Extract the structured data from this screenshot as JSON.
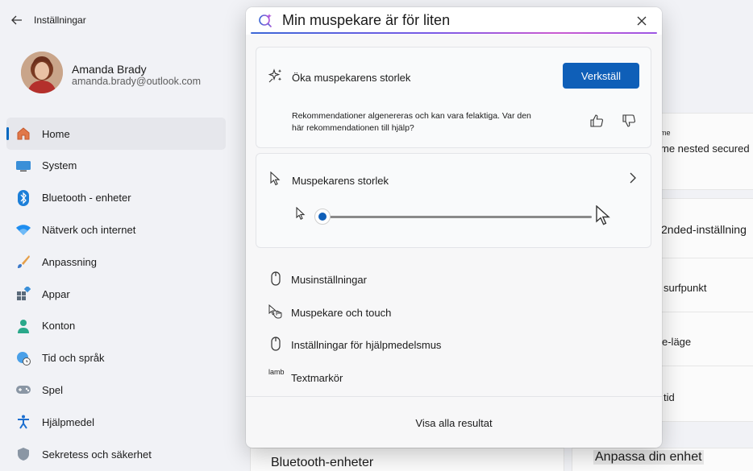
{
  "app": {
    "title": "Inställningar",
    "back_icon": "arrow-left-icon"
  },
  "profile": {
    "name": "Amanda Brady",
    "email": "amanda.brady@outlook.com"
  },
  "nav": [
    {
      "label": "Home",
      "icon": "home-icon",
      "active": true
    },
    {
      "label": "System",
      "icon": "monitor-icon"
    },
    {
      "label": "Bluetooth - enheter",
      "icon": "bluetooth-icon"
    },
    {
      "label": "Nätverk och internet",
      "icon": "wifi-icon"
    },
    {
      "label": "Anpassning",
      "icon": "brush-icon"
    },
    {
      "label": "Appar",
      "icon": "apps-icon"
    },
    {
      "label": "Konton",
      "icon": "person-icon"
    },
    {
      "label": "Tid och språk",
      "icon": "globe-clock-icon"
    },
    {
      "label": "Spel",
      "icon": "gamepad-icon"
    },
    {
      "label": "Hjälpmedel",
      "icon": "accessibility-icon"
    },
    {
      "label": "Sekretess och säkerhet",
      "icon": "shield-icon"
    }
  ],
  "background": {
    "fragment_me": "me",
    "fragment_nested": "me nested secured",
    "fragment_2nded": "2nded-inställning",
    "fragment_surfpunkt": "surfpunkt",
    "fragment_lage": "e-läge",
    "fragment_tid": "tid",
    "bottom_left_title": "Bluetooth-enheter",
    "bottom_right_title": "Anpassa din enhet"
  },
  "search": {
    "query": "Min muspekare är för liten"
  },
  "recommendation": {
    "title": "Öka muspekarens storlek",
    "apply_label": "Verkställ",
    "note": "Rekommendationer algenereras och kan vara felaktiga. Var den här rekommendationen till hjälp?"
  },
  "pointer_size": {
    "title": "Muspekarens storlek",
    "slider_value": 0
  },
  "results": [
    {
      "label": "Musinställningar",
      "icon": "mouse-icon"
    },
    {
      "label": "Muspekare och touch",
      "icon": "pointer-touch-icon"
    },
    {
      "label": "Inställningar för hjälpmedelsmus",
      "icon": "mouse-icon"
    },
    {
      "label": "Textmarkör",
      "prefix": "lamb"
    }
  ],
  "footer": {
    "show_all": "Visa alla resultat"
  },
  "colors": {
    "accent": "#0f5fb8",
    "nav_indicator": "#0067c0"
  }
}
